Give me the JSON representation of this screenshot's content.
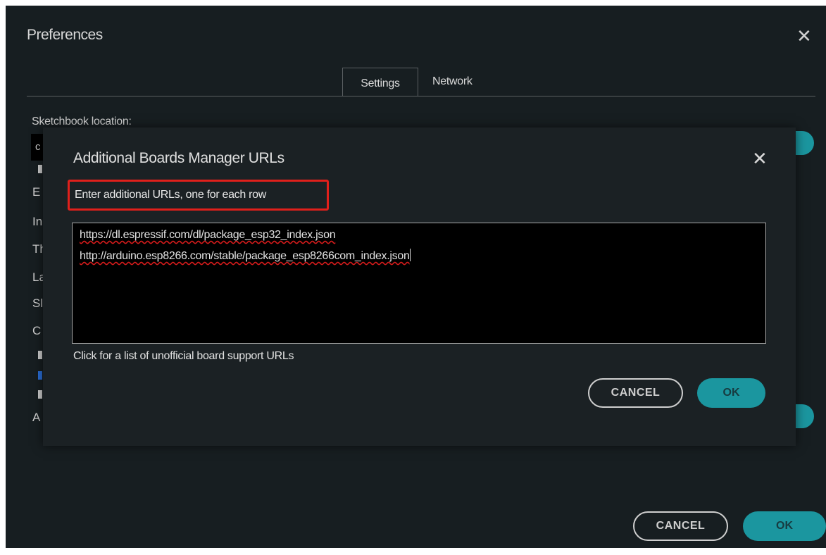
{
  "preferences": {
    "title": "Preferences",
    "close_glyph": "✕",
    "tabs": [
      {
        "label": "Settings",
        "active": true
      },
      {
        "label": "Network",
        "active": false
      }
    ],
    "sketchbook_label": "Sketchbook location:",
    "cancel_label": "CANCEL",
    "ok_label": "OK"
  },
  "dialog": {
    "title": "Additional Boards Manager URLs",
    "close_glyph": "✕",
    "instruction": "Enter additional URLs, one for each row",
    "urls": [
      "https://dl.espressif.com/dl/package_esp32_index.json",
      "http://arduino.esp8266.com/stable/package_esp8266com_index.json"
    ],
    "unofficial_link": "Click for a list of unofficial board support URLs",
    "cancel_label": "CANCEL",
    "ok_label": "OK"
  },
  "colors": {
    "background": "#171e21",
    "accent": "#1b969f",
    "highlight_border": "#e0201b"
  }
}
